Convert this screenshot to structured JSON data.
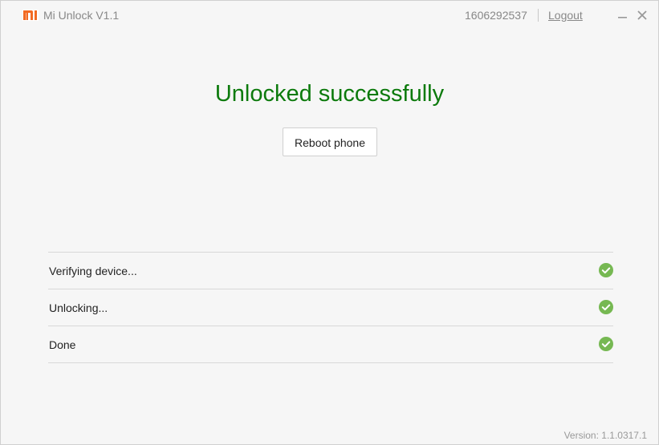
{
  "titlebar": {
    "app_name": "Mi Unlock  V1.1",
    "account_id": "1606292537",
    "logout_label": "Logout",
    "brand_color": "#f26a22"
  },
  "main": {
    "status_title": "Unlocked successfully",
    "status_color": "#0c7a0c",
    "reboot_label": "Reboot phone"
  },
  "steps": [
    {
      "label": "Verifying device...",
      "icon": "check-circle-icon",
      "state": "done"
    },
    {
      "label": "Unlocking...",
      "icon": "check-circle-icon",
      "state": "done"
    },
    {
      "label": "Done",
      "icon": "check-circle-icon",
      "state": "done"
    }
  ],
  "check_color": "#76b852",
  "footer": {
    "version": "Version: 1.1.0317.1"
  }
}
